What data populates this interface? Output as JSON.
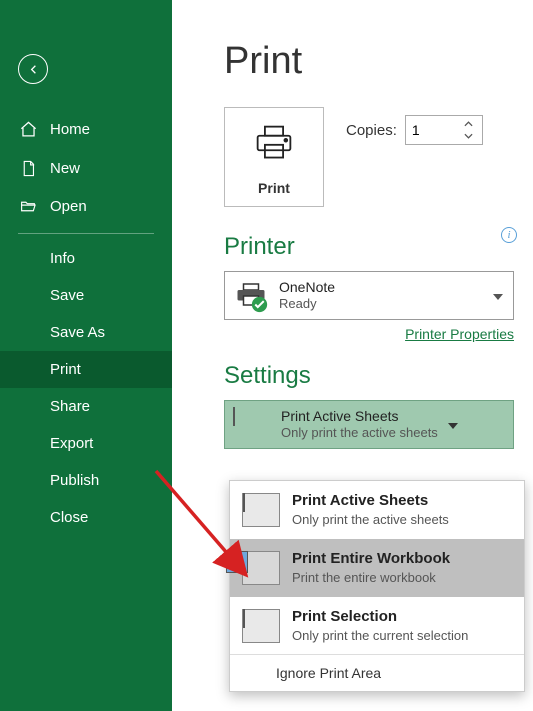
{
  "sidebar": {
    "primary": {
      "home": "Home",
      "new": "New",
      "open": "Open"
    },
    "secondary": {
      "info": "Info",
      "save": "Save",
      "saveas": "Save As",
      "print": "Print",
      "share": "Share",
      "export": "Export",
      "publish": "Publish",
      "close": "Close"
    }
  },
  "page": {
    "title": "Print",
    "print_button_label": "Print",
    "copies_label": "Copies:",
    "copies_value": "1"
  },
  "printer": {
    "heading": "Printer",
    "name": "OneNote",
    "status": "Ready",
    "properties_link": "Printer Properties",
    "info_glyph": "i"
  },
  "settings": {
    "heading": "Settings",
    "selected_title": "Print Active Sheets",
    "selected_sub": "Only print the active sheets",
    "options": [
      {
        "title": "Print Active Sheets",
        "sub": "Only print the active sheets"
      },
      {
        "title": "Print Entire Workbook",
        "sub": "Print the entire workbook"
      },
      {
        "title": "Print Selection",
        "sub": "Only print the current selection"
      }
    ],
    "footer": "Ignore Print Area",
    "hovered_index": 1
  },
  "colors": {
    "accent": "#197b43",
    "sidebar": "#0f703b",
    "sidebar_selected": "#0a5a2e"
  }
}
